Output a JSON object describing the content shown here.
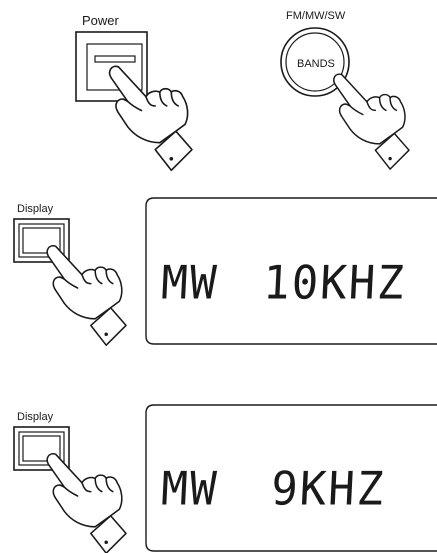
{
  "power": {
    "label": "Power"
  },
  "bands": {
    "top_label": "FM/MW/SW",
    "button_label": "BANDS"
  },
  "step1": {
    "display_label": "Display",
    "lcd": {
      "band": "MW",
      "step": "10KHZ"
    }
  },
  "step2": {
    "display_label": "Display",
    "lcd": {
      "band": "MW",
      "step": "9KHZ"
    }
  }
}
